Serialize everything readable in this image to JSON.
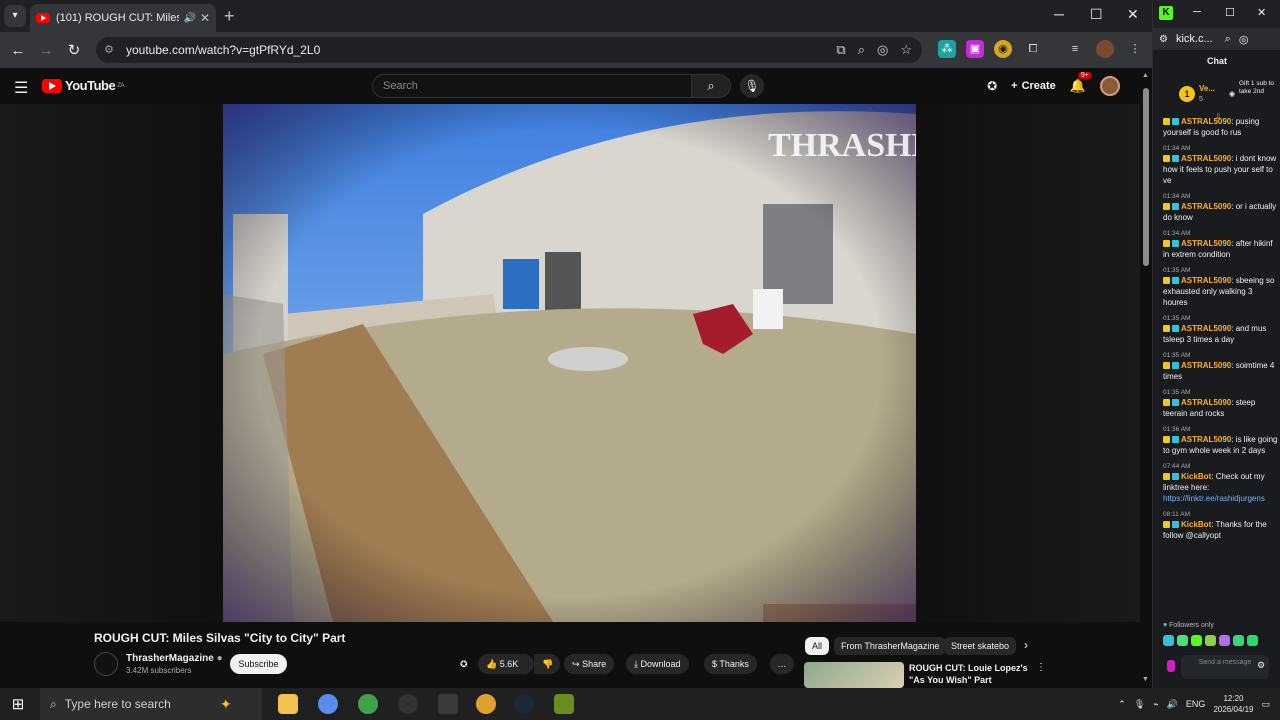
{
  "browser": {
    "tab_title": "(101) ROUGH CUT: Miles Si",
    "new_tab": "+",
    "url": "youtube.com/watch?v=gtPfRYd_2L0",
    "window_controls": {
      "minimize": "─",
      "maximize": "☐",
      "close": "✕"
    },
    "nav": {
      "back": "←",
      "forward": "→",
      "reload": "↻"
    }
  },
  "youtube": {
    "logo_text": "YouTube",
    "logo_region": "ZA",
    "search_placeholder": "Search",
    "create_label": "Create",
    "notification_count": "9+",
    "video": {
      "title": "ROUGH CUT: Miles Silvas \"City to City\" Part",
      "watermark": "THRASHER",
      "channel_name": "ThrasherMagazine",
      "channel_subs": "3.42M subscribers",
      "subscribe_label": "Subscribe",
      "likes": "5.6K",
      "share_label": "Share",
      "download_label": "Download",
      "thanks_label": "Thanks",
      "more_label": "…"
    },
    "chips": [
      "All",
      "From ThrasherMagazine",
      "Street skatebo"
    ],
    "recommendation": {
      "title": "ROUGH CUT: Louie Lopez's \"As You Wish\" Part"
    }
  },
  "kick": {
    "app_short_url": "kick.c...",
    "chat_title": "Chat",
    "gift_rank": "1",
    "gift_user": "Ve...",
    "gift_count": "5",
    "gift_text": "Gift 1 sub to take 2nd",
    "messages": [
      {
        "time": "",
        "user": "ASTRAL5090",
        "text": "pusing yourself is good fo rus"
      },
      {
        "time": "01:34 AM",
        "user": "ASTRAL5090",
        "text": "i dont know how it feels to push your self to ve"
      },
      {
        "time": "01:34 AM",
        "user": "ASTRAL5090",
        "text": "or i actually do know"
      },
      {
        "time": "01:34 AM",
        "user": "ASTRAL5090",
        "text": "after hikinf in extrem condition"
      },
      {
        "time": "01:35 AM",
        "user": "ASTRAL5090",
        "text": "sbeeing so exhausted only walking 3 houres"
      },
      {
        "time": "01:35 AM",
        "user": "ASTRAL5090",
        "text": "and mus tsleep 3 times a day"
      },
      {
        "time": "01:35 AM",
        "user": "ASTRAL5090",
        "text": "soimtime 4 times"
      },
      {
        "time": "01:35 AM",
        "user": "ASTRAL5090",
        "text": "steep teerain and rocks"
      },
      {
        "time": "01:36 AM",
        "user": "ASTRAL5090",
        "text": "is like going to gym whole week in 2 days"
      },
      {
        "time": "07:44 AM",
        "user": "KickBot",
        "text": "Check out my linktree here:",
        "link": "https://linktr.ee/rashidjurgens"
      },
      {
        "time": "08:11 AM",
        "user": "KickBot",
        "text": "Thanks for the follow @callyopt"
      }
    ],
    "followers_only": "Followers only",
    "input_placeholder": "Send a message"
  },
  "taskbar": {
    "search_placeholder": "Type here to search",
    "language": "ENG",
    "time": "12:20",
    "date": "2026/04/19"
  }
}
